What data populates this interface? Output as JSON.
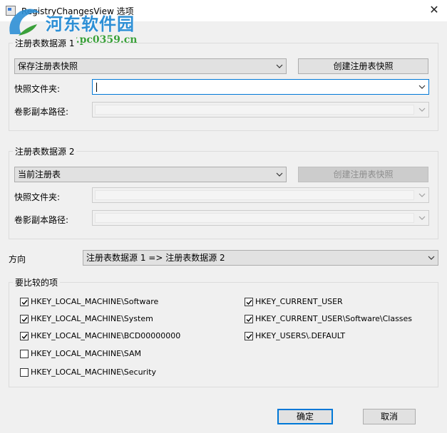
{
  "window": {
    "title": "RegistryChangesView 选项",
    "close_glyph": "✕"
  },
  "watermark": {
    "title": "河东软件园",
    "url": "www.pc0359.cn"
  },
  "source1": {
    "legend": "注册表数据源 1",
    "type_value": "保存注册表快照",
    "create_snapshot_label": "创建注册表快照",
    "snapshot_folder_label": "快照文件夹:",
    "snapshot_folder_value": "",
    "shadow_copy_label": "卷影副本路径:",
    "shadow_copy_value": ""
  },
  "source2": {
    "legend": "注册表数据源 2",
    "type_value": "当前注册表",
    "create_snapshot_label": "创建注册表快照",
    "snapshot_folder_label": "快照文件夹:",
    "snapshot_folder_value": "",
    "shadow_copy_label": "卷影副本路径:",
    "shadow_copy_value": ""
  },
  "direction": {
    "label": "方向",
    "value": "注册表数据源 1 => 注册表数据源 2"
  },
  "compare": {
    "legend": "要比较的项",
    "items": [
      {
        "label": "HKEY_LOCAL_MACHINE\\Software",
        "checked": true
      },
      {
        "label": "HKEY_LOCAL_MACHINE\\System",
        "checked": true
      },
      {
        "label": "HKEY_LOCAL_MACHINE\\BCD00000000",
        "checked": true
      },
      {
        "label": "HKEY_LOCAL_MACHINE\\SAM",
        "checked": false
      },
      {
        "label": "HKEY_LOCAL_MACHINE\\Security",
        "checked": false
      },
      {
        "label": "HKEY_CURRENT_USER",
        "checked": true
      },
      {
        "label": "HKEY_CURRENT_USER\\Software\\Classes",
        "checked": true
      },
      {
        "label": "HKEY_USERS\\.DEFAULT",
        "checked": true
      }
    ]
  },
  "buttons": {
    "ok": "确定",
    "cancel": "取消"
  },
  "colors": {
    "accent": "#0078d7",
    "watermark_blue": "#2d8fd5",
    "watermark_green": "#3aa03a"
  }
}
